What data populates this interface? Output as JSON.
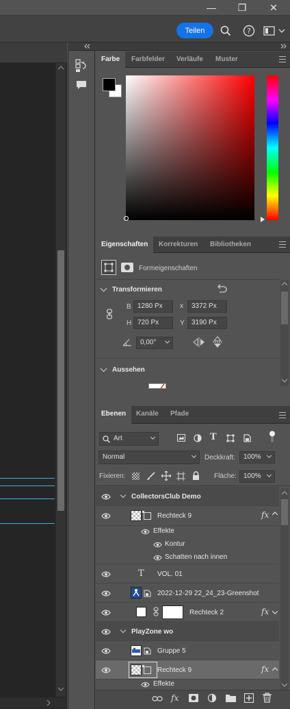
{
  "window": {
    "minimize_glyph": "—",
    "maximize_glyph": "❐",
    "close_glyph": "✕"
  },
  "options_bar": {
    "share_label": "Teilen",
    "icons": [
      "search-icon",
      "help-icon",
      "workspace-icon"
    ]
  },
  "toolstrip": {
    "icons": [
      "history-icon",
      "comment-icon"
    ]
  },
  "color_panel": {
    "tabs": [
      "Farbe",
      "Farbfelder",
      "Verläufe",
      "Muster"
    ],
    "active_tab": "Farbe",
    "foreground": "#000000",
    "background": "#ffffff",
    "hue": "#ff0000"
  },
  "properties_panel": {
    "tabs": [
      "Eigenschaften",
      "Korrekturen",
      "Bibliotheken"
    ],
    "active_tab": "Eigenschaften",
    "shape_properties_label": "Formeigenschaften",
    "transform_section": "Transformieren",
    "w_label": "B",
    "w_value": "1280 Px",
    "x_label": "x",
    "x_value": "3372 Px",
    "h_label": "H",
    "h_value": "720 Px",
    "y_label": "Y",
    "y_value": "3190 Px",
    "angle_value": "0,00°",
    "appearance_section": "Aussehen"
  },
  "layers_panel": {
    "tabs": [
      "Ebenen",
      "Kanäle",
      "Pfade"
    ],
    "active_tab": "Ebenen",
    "filter_label": "Art",
    "blend_mode": "Normal",
    "opacity_label": "Deckkraft:",
    "opacity_value": "100%",
    "lock_label": "Fixieren:",
    "fill_label": "Fläche:",
    "fill_value": "100%",
    "layers": [
      {
        "name": "CollectorsClub Demo",
        "kind": "group"
      },
      {
        "name": "Rechteck 9",
        "kind": "shape",
        "fx": "fx"
      },
      {
        "name": "Effekte",
        "kind": "effects"
      },
      {
        "name": "Kontur",
        "kind": "effect"
      },
      {
        "name": "Schatten nach innen",
        "kind": "effect"
      },
      {
        "name": "VOL. 01",
        "kind": "text",
        "type_glyph": "T"
      },
      {
        "name": "2022-12-29 22_24_23-Greenshot",
        "kind": "smart"
      },
      {
        "name": "Rechteck 2",
        "kind": "shape-linked",
        "fx": "fx"
      },
      {
        "name": "PlayZone wo",
        "kind": "group"
      },
      {
        "name": "Gruppe 5",
        "kind": "smart"
      },
      {
        "name": "Rechteck 9",
        "kind": "shape",
        "fx": "fx",
        "selected": true
      },
      {
        "name": "Effekte",
        "kind": "effects"
      }
    ],
    "footer_icons": [
      "link-icon",
      "fx-icon",
      "mask-icon",
      "adjustment-icon",
      "folder-icon",
      "new-layer-icon",
      "trash-icon"
    ],
    "footer_fx": "fx"
  }
}
